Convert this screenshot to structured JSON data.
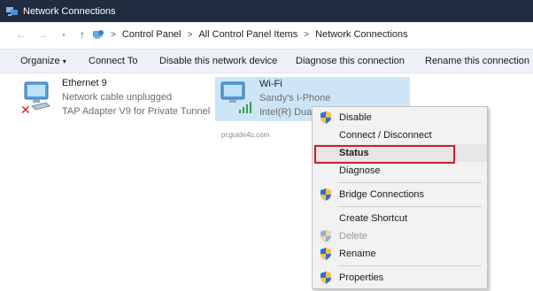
{
  "window": {
    "title": "Network Connections"
  },
  "address": {
    "crumbs": [
      "Control Panel",
      "All Control Panel Items",
      "Network Connections"
    ]
  },
  "commands": {
    "organize": "Organize",
    "organize_arrow": "▾",
    "connect_to": "Connect To",
    "disable_device": "Disable this network device",
    "diagnose": "Diagnose this connection",
    "rename": "Rename this connection"
  },
  "adapters": {
    "ethernet": {
      "name": "Ethernet 9",
      "status": "Network cable unplugged",
      "device": "TAP Adapter V9 for Private Tunnel"
    },
    "wifi": {
      "name": "Wi-Fi",
      "status": "Sandy's I-Phone",
      "device": "Intel(R) Dual"
    }
  },
  "watermark": "pcguide4u.com",
  "context_menu": {
    "items": [
      {
        "label": "Disable"
      },
      {
        "label": "Connect / Disconnect"
      },
      {
        "label": "Status"
      },
      {
        "label": "Diagnose"
      },
      {
        "label": "Bridge Connections"
      },
      {
        "label": "Create Shortcut"
      },
      {
        "label": "Delete"
      },
      {
        "label": "Rename"
      },
      {
        "label": "Properties"
      }
    ]
  },
  "colors": {
    "titlebar": "#1f2b3f",
    "selection": "#cde6f7",
    "highlight_box": "#d11e2a"
  }
}
